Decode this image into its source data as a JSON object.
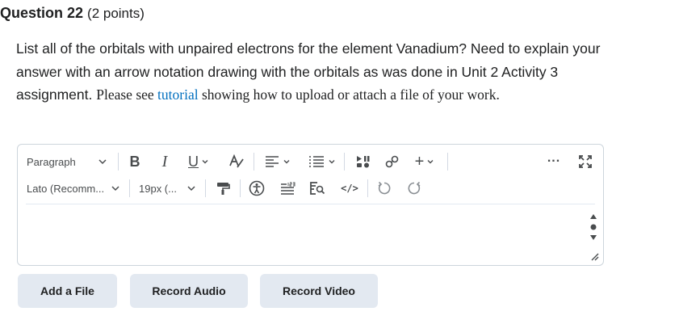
{
  "question": {
    "title": "Question 22",
    "points": "(2 points)",
    "body_sans": "List all of the orbitals with unpaired electrons for the element Vanadium? Need to explain your answer with an arrow notation drawing with the orbitals as was done in Unit 2 Activity 3 assignment.",
    "body_serif_pre": "Please see ",
    "link_text": "tutorial",
    "body_serif_post": " showing how to upload or attach a file of your work."
  },
  "editor": {
    "format_select": "Paragraph",
    "font_select": "Lato (Recomm...",
    "size_select": "19px (...",
    "bold": "B",
    "italic": "I",
    "underline": "U",
    "insert_plus": "+",
    "more": "...",
    "code": "</>",
    "icons": [
      "chevron-down-icon",
      "bold-icon",
      "italic-icon",
      "underline-icon",
      "text-color-icon",
      "align-icon",
      "list-icon",
      "media-icon",
      "link-icon",
      "insert-icon",
      "more-icon",
      "fullscreen-icon",
      "format-painter-icon",
      "accessibility-icon",
      "word-count-icon",
      "find-replace-icon",
      "source-code-icon",
      "undo-icon",
      "redo-icon",
      "resize-handle-icon"
    ]
  },
  "actions": {
    "add_file": "Add a File",
    "record_audio": "Record Audio",
    "record_video": "Record Video"
  },
  "colors": {
    "link": "#006fbf",
    "button_bg": "#e3e9f1",
    "border": "#cdd5dc",
    "text": "#202122"
  }
}
